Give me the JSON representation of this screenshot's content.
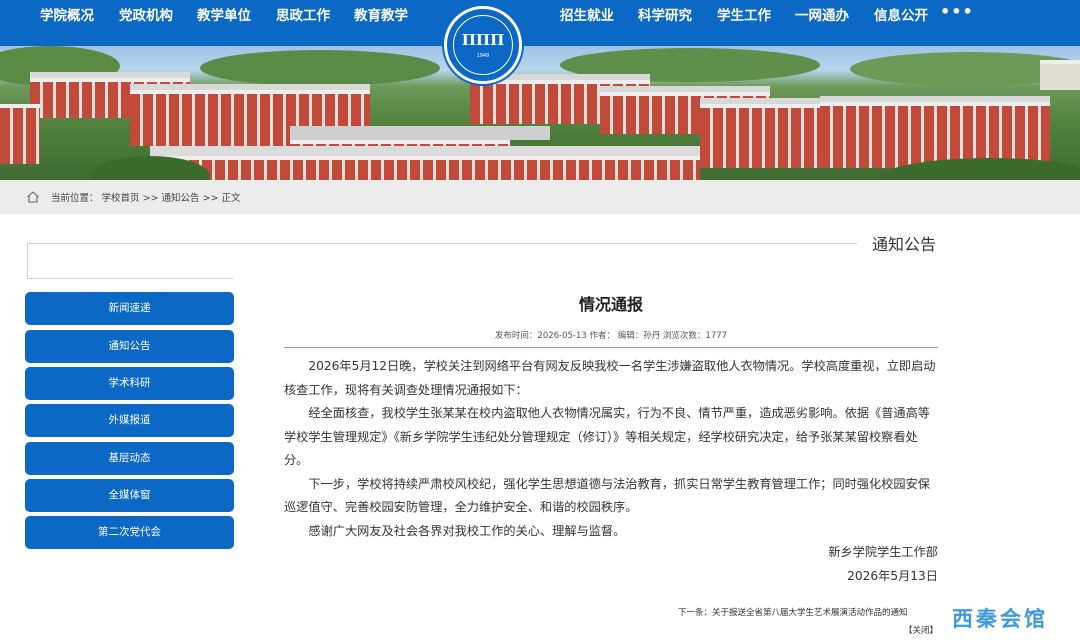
{
  "nav": {
    "left": [
      "学院概况",
      "党政机构",
      "教学单位",
      "思政工作",
      "教育教学"
    ],
    "right": [
      "招生就业",
      "科学研究",
      "学生工作",
      "一网通办",
      "信息公开"
    ],
    "more": "•••"
  },
  "logo": {
    "mark": "ΠΠΠ",
    "year": "1949"
  },
  "breadcrumb": {
    "label": "当前位置：",
    "items": [
      "学校首页",
      "通知公告",
      "正文"
    ],
    "sep": " >> "
  },
  "section": {
    "title": "通知公告"
  },
  "sidebar": {
    "items": [
      "新闻速递",
      "通知公告",
      "学术科研",
      "外媒报道",
      "基层动态",
      "全媒体窗",
      "第二次党代会"
    ]
  },
  "article": {
    "title": "情况通报",
    "meta": "发布时间：2026-05-13 作者：   编辑：孙丹 浏览次数：1777",
    "paragraphs": [
      "2026年5月12日晚，学校关注到网络平台有网友反映我校一名学生涉嫌盗取他人衣物情况。学校高度重视，立即启动核查工作，现将有关调查处理情况通报如下：",
      "经全面核查，我校学生张某某在校内盗取他人衣物情况属实，行为不良、情节严重，造成恶劣影响。依据《普通高等学校学生管理规定》《新乡学院学生违纪处分管理规定（修订）》等相关规定，经学校研究决定，给予张某某留校察看处分。",
      "下一步，学校将持续严肃校风校纪，强化学生思想道德与法治教育，抓实日常学生教育管理工作；同时强化校园安保巡逻值守、完善校园安防管理，全力维护安全、和谐的校园秩序。",
      "感谢广大网友及社会各界对我校工作的关心、理解与监督。"
    ],
    "signature": "新乡学院学生工作部",
    "date": "2026年5月13日",
    "next": "下一条：关于报送全省第八届大学生艺术展演活动作品的通知",
    "close": "【关闭】"
  },
  "watermark": "西秦会馆",
  "colors": {
    "primary": "#0b68c4",
    "crumb_bg": "#ececec"
  }
}
